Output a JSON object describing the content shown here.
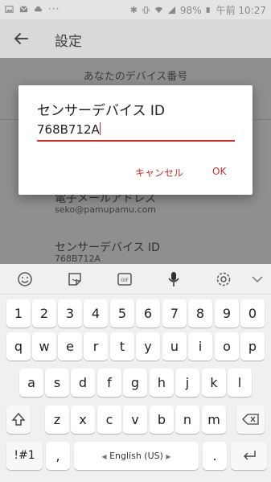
{
  "status_bar": {
    "battery": "98%",
    "time": "午前 10:27",
    "notification_icons": [
      "image-icon",
      "gmail-icon",
      "cloud-icon",
      "more-icon"
    ],
    "system_icons": [
      "bluetooth-icon",
      "vibrate-icon",
      "wifi-icon",
      "signal-icon",
      "battery-icon"
    ]
  },
  "app_bar": {
    "title": "設定"
  },
  "settings": {
    "section_header": "あなたのデバイス番号",
    "rows": [
      {
        "title": "電子メールアドレス",
        "subtitle": "seko@pamupamu.com"
      },
      {
        "title": "センサーデバイス ID",
        "subtitle": "768B712A"
      }
    ]
  },
  "dialog": {
    "title": "センサーデバイス ID",
    "input_value": "768B712A",
    "cancel_label": "キャンセル",
    "ok_label": "OK"
  },
  "keyboard": {
    "toolbar_icons": [
      "emoji-icon",
      "sticker-icon",
      "gif-icon",
      "mic-icon",
      "settings-icon",
      "collapse-icon"
    ],
    "number_row": [
      "1",
      "2",
      "3",
      "4",
      "5",
      "6",
      "7",
      "8",
      "9",
      "0"
    ],
    "row1": [
      "q",
      "w",
      "e",
      "r",
      "t",
      "y",
      "u",
      "i",
      "o",
      "p"
    ],
    "row2": [
      "a",
      "s",
      "d",
      "f",
      "g",
      "h",
      "j",
      "k",
      "l"
    ],
    "row3": [
      "z",
      "x",
      "c",
      "v",
      "b",
      "n",
      "m"
    ],
    "symbols_label": "!#1",
    "comma_label": ",",
    "space_label": "English (US)",
    "period_label": "."
  }
}
